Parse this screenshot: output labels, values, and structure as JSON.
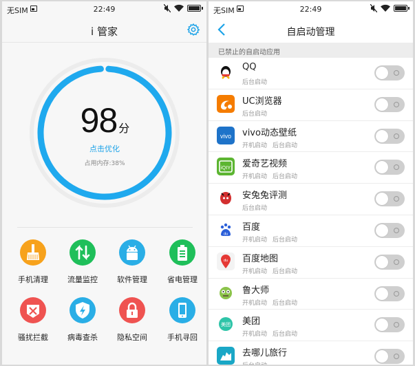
{
  "status_bar": {
    "carrier": "无SIM",
    "time": "22:49"
  },
  "guard": {
    "title": "i 管家",
    "score": "98",
    "score_unit": "分",
    "optimize_label": "点击优化",
    "memory_label": "占用内存:38%",
    "memory_percent": 38,
    "tools": [
      {
        "label": "手机清理",
        "icon": "broom-icon",
        "color": "#f7a21c"
      },
      {
        "label": "流量监控",
        "icon": "updown-arrows-icon",
        "color": "#1fbf5a"
      },
      {
        "label": "软件管理",
        "icon": "android-icon",
        "color": "#2aaee6"
      },
      {
        "label": "省电管理",
        "icon": "battery-icon",
        "color": "#1fbf5a"
      },
      {
        "label": "骚扰拦截",
        "icon": "block-phone-icon",
        "color": "#ef5351"
      },
      {
        "label": "病毒查杀",
        "icon": "shield-bolt-icon",
        "color": "#2aaee6"
      },
      {
        "label": "隐私空间",
        "icon": "lock-icon",
        "color": "#ef5351"
      },
      {
        "label": "手机寻回",
        "icon": "phone-icon",
        "color": "#2aaee6"
      }
    ]
  },
  "autostart": {
    "title": "自启动管理",
    "section_header": "已禁止的自启动应用",
    "apps": [
      {
        "name": "QQ",
        "subs": [
          "后台启动"
        ],
        "icon": "qq-icon",
        "enabled": false
      },
      {
        "name": "UC浏览器",
        "subs": [
          "后台启动"
        ],
        "icon": "uc-browser-icon",
        "enabled": false
      },
      {
        "name": "vivo动态壁纸",
        "subs": [
          "开机启动",
          "后台启动"
        ],
        "icon": "vivo-icon",
        "enabled": false
      },
      {
        "name": "爱奇艺视频",
        "subs": [
          "开机启动",
          "后台启动"
        ],
        "icon": "iqiyi-icon",
        "enabled": false
      },
      {
        "name": "安兔兔评测",
        "subs": [
          "后台启动"
        ],
        "icon": "antutu-icon",
        "enabled": false
      },
      {
        "name": "百度",
        "subs": [
          "开机启动",
          "后台启动"
        ],
        "icon": "baidu-icon",
        "enabled": false
      },
      {
        "name": "百度地图",
        "subs": [
          "开机启动",
          "后台启动"
        ],
        "icon": "baidu-map-icon",
        "enabled": false
      },
      {
        "name": "鲁大师",
        "subs": [
          "开机启动",
          "后台启动"
        ],
        "icon": "ludashi-icon",
        "enabled": false
      },
      {
        "name": "美团",
        "subs": [
          "开机启动",
          "后台启动"
        ],
        "icon": "meituan-icon",
        "enabled": false
      },
      {
        "name": "去哪儿旅行",
        "subs": [
          "后台启动"
        ],
        "icon": "qunar-icon",
        "enabled": false
      }
    ]
  }
}
